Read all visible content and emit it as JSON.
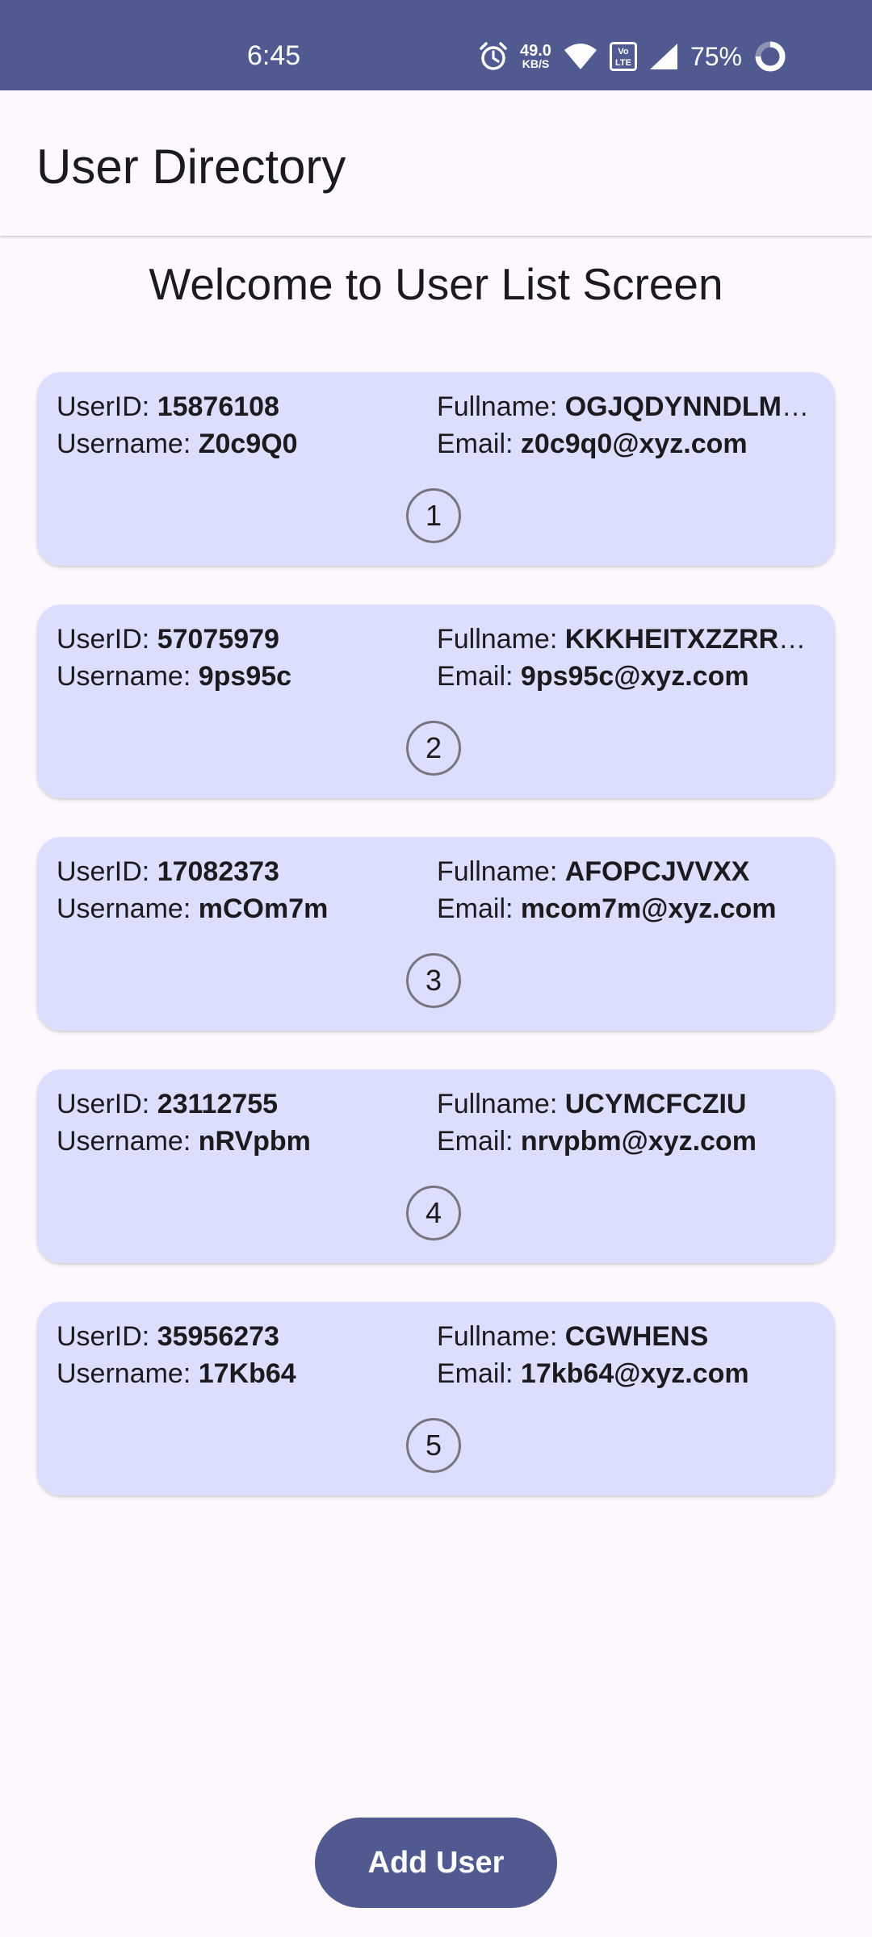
{
  "status_bar": {
    "time": "6:45",
    "net_speed_value": "49.0",
    "net_speed_unit": "KB/S",
    "volte_label": "Vo LTE",
    "battery_percent": "75%",
    "icons": [
      "alarm-icon",
      "wifi-icon",
      "volte-icon",
      "signal-icon",
      "battery-ring-icon"
    ]
  },
  "app_bar": {
    "title": "User Directory"
  },
  "main": {
    "welcome": "Welcome to User List Screen",
    "labels": {
      "user_id": "UserID:",
      "username": "Username:",
      "fullname": "Fullname:",
      "email": "Email:"
    },
    "users": [
      {
        "index": "1",
        "user_id": "15876108",
        "username": "Z0c9Q0",
        "fullname": "OGJQDYNNDLMF…",
        "email": "z0c9q0@xyz.com"
      },
      {
        "index": "2",
        "user_id": "57075979",
        "username": "9ps95c",
        "fullname": "KKKHEITXZZRRXN",
        "email": "9ps95c@xyz.com"
      },
      {
        "index": "3",
        "user_id": "17082373",
        "username": "mCOm7m",
        "fullname": "AFOPCJVVXX",
        "email": "mcom7m@xyz.com"
      },
      {
        "index": "4",
        "user_id": "23112755",
        "username": "nRVpbm",
        "fullname": "UCYMCFCZIU",
        "email": "nrvpbm@xyz.com"
      },
      {
        "index": "5",
        "user_id": "35956273",
        "username": "17Kb64",
        "fullname": "CGWHENS",
        "email": "17kb64@xyz.com"
      }
    ]
  },
  "actions": {
    "add_user_label": "Add User"
  },
  "colors": {
    "primary": "#505a90",
    "card_background": "#dcdefd",
    "page_background": "#fcf8fd"
  }
}
